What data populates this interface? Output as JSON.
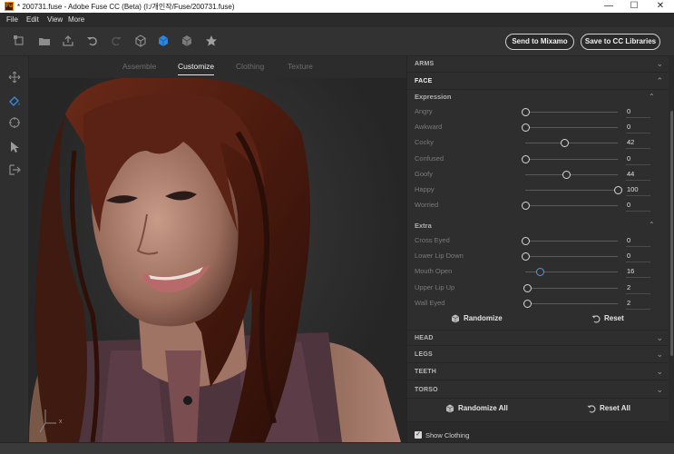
{
  "window": {
    "title": "* 200731.fuse - Adobe Fuse CC (Beta) (I:/개인작/Fuse/200731.fuse)",
    "app_icon": "Fu",
    "minimize": "—",
    "maximize": "☐",
    "close": "✕"
  },
  "menu": {
    "items": [
      "File",
      "Edit",
      "View",
      "More"
    ]
  },
  "toolbar": {
    "icons": [
      "import-icon",
      "open-folder-icon",
      "export-icon",
      "undo-icon",
      "redo-icon",
      "cube-outline-icon",
      "cube-solid-icon",
      "cube-half-icon",
      "star-icon"
    ],
    "send_to_mixamo": "Send to Mixamo",
    "save_to_cc": "Save to CC Libraries"
  },
  "left_tools": [
    "move-icon",
    "paint-icon",
    "target-icon",
    "pointer-icon",
    "export-tool-icon"
  ],
  "tabs": [
    "Assemble",
    "Customize",
    "Clothing",
    "Texture"
  ],
  "active_tab": "Customize",
  "panel": {
    "arms": "ARMS",
    "face": "FACE",
    "expression": {
      "title": "Expression",
      "sliders": [
        {
          "name": "Angry",
          "value": "0",
          "fraction": 0.0
        },
        {
          "name": "Awkward",
          "value": "0",
          "fraction": 0.0
        },
        {
          "name": "Cocky",
          "value": "42",
          "fraction": 0.42
        },
        {
          "name": "Confused",
          "value": "0",
          "fraction": 0.0
        },
        {
          "name": "Goofy",
          "value": "44",
          "fraction": 0.44
        },
        {
          "name": "Happy",
          "value": "100",
          "fraction": 1.0
        },
        {
          "name": "Worried",
          "value": "0",
          "fraction": 0.0
        }
      ]
    },
    "extra": {
      "title": "Extra",
      "sliders": [
        {
          "name": "Cross Eyed",
          "value": "0",
          "fraction": 0.0
        },
        {
          "name": "Lower Lip Down",
          "value": "0",
          "fraction": 0.0
        },
        {
          "name": "Mouth Open",
          "value": "16",
          "fraction": 0.16,
          "active": true
        },
        {
          "name": "Upper Lip Up",
          "value": "2",
          "fraction": 0.02
        },
        {
          "name": "Wall Eyed",
          "value": "2",
          "fraction": 0.02
        }
      ]
    },
    "randomize": "Randomize",
    "reset": "Reset",
    "head": "HEAD",
    "legs": "LEGS",
    "teeth": "TEETH",
    "torso": "TORSO",
    "randomize_all": "Randomize All",
    "reset_all": "Reset All",
    "show_clothing": "Show Clothing",
    "show_clothing_checked": true
  },
  "viewport": {
    "axis_x": "x",
    "colors": {
      "background": "#2a2a2a",
      "hair": "#4a1c10",
      "skin": "#b88a78",
      "top": "#5a3c44"
    }
  },
  "colors": {
    "accent": "#3a8ee6",
    "panel_bg": "#2e2e2e",
    "toolbar_bg": "#323232"
  }
}
